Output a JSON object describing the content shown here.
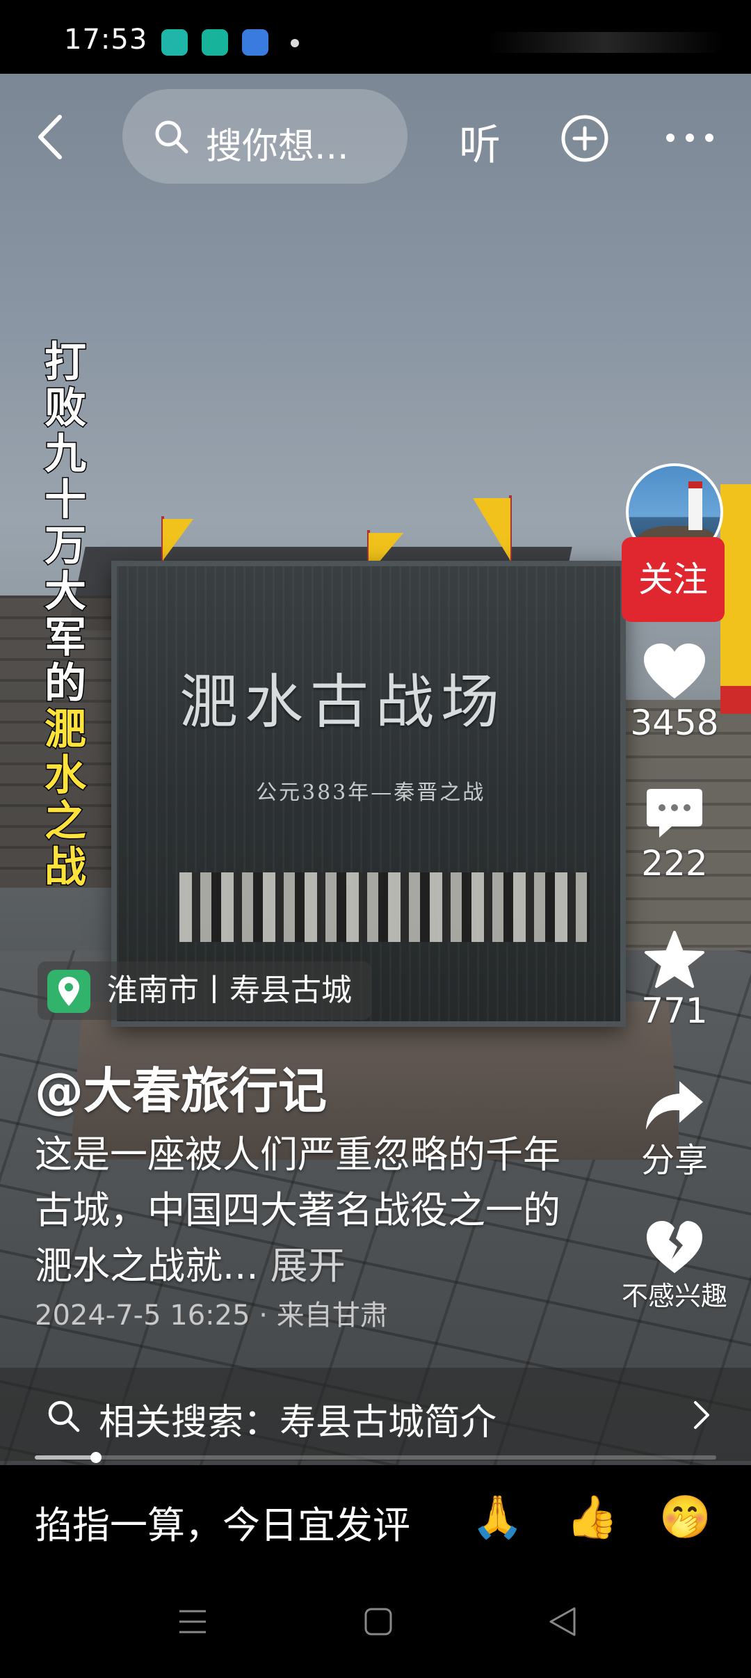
{
  "status_bar": {
    "time": "17:53",
    "app_icons": [
      {
        "name": "store-app-icon",
        "color": "#1fb5a8"
      },
      {
        "name": "calendar-app-icon",
        "color": "#18b39b"
      },
      {
        "name": "browser-app-icon",
        "color": "#3a7be0"
      }
    ]
  },
  "top_bar": {
    "search_placeholder": "搜你想...",
    "listen_label": "听"
  },
  "video": {
    "vertical_title": [
      "打",
      "败",
      "九",
      "十",
      "万",
      "大",
      "军",
      "的"
    ],
    "vertical_title_highlight": [
      "淝",
      "水",
      "之",
      "战"
    ],
    "monument_title": "淝水古战场",
    "monument_subtitle": "公元383年—秦晋之战"
  },
  "side_actions": {
    "follow_label": "关注",
    "like_count": "3458",
    "comment_count": "222",
    "favorite_count": "771",
    "share_label": "分享",
    "dislike_label": "不感兴趣"
  },
  "post": {
    "location": "淮南市丨寿县古城",
    "author": "@大春旅行记",
    "description": "这是一座被人们严重忽略的千年古城，中国四大著名战役之一的淝水之战就...",
    "expand_label": "展开",
    "meta": "2024-7-5 16:25 · 来自甘肃"
  },
  "related_search": {
    "text": "相关搜索：寿县古城简介"
  },
  "playback": {
    "progress": 0.09
  },
  "comment_bar": {
    "prompt": "掐指一算，今日宜发评",
    "emojis": [
      {
        "name": "clap-hands-icon",
        "glyph": "🙏"
      },
      {
        "name": "thumbs-up-icon",
        "glyph": "👍"
      },
      {
        "name": "giggle-face-icon",
        "glyph": "🤭"
      }
    ]
  },
  "accent_colors": {
    "follow": "#e0262f",
    "highlight": "#ffe33a",
    "location_icon": "#31b36b"
  }
}
